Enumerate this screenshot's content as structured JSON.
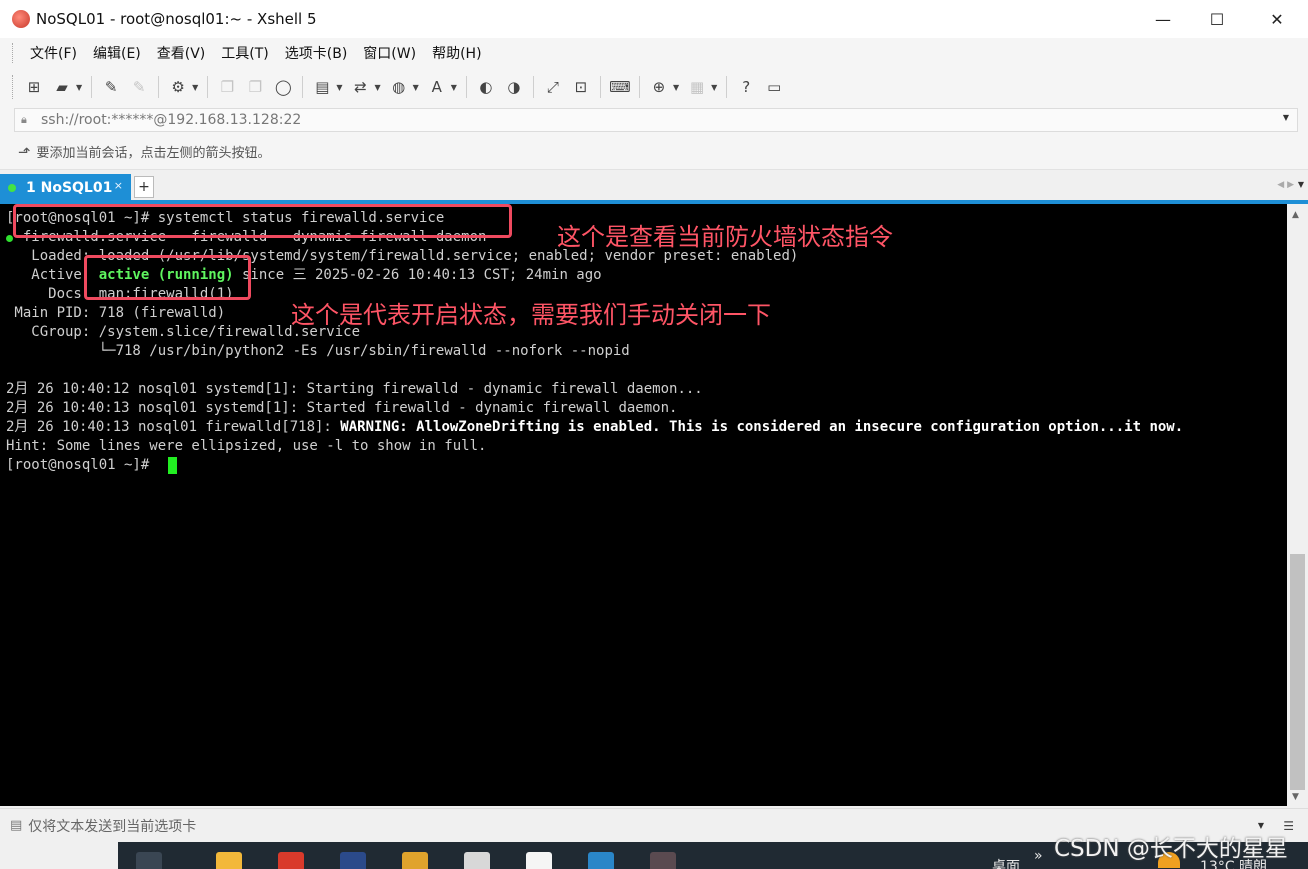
{
  "window": {
    "title": "NoSQL01 - root@nosql01:~ - Xshell 5",
    "minimize": "—",
    "maximize": "☐",
    "close": "✕"
  },
  "menu": [
    "文件(F)",
    "编辑(E)",
    "查看(V)",
    "工具(T)",
    "选项卡(B)",
    "窗口(W)",
    "帮助(H)"
  ],
  "address": {
    "url": "ssh://root:******@192.168.13.128:22"
  },
  "hint": {
    "text": "要添加当前会话，点击左侧的箭头按钮。"
  },
  "tab": {
    "label": "1 NoSQL01",
    "close": "×",
    "add": "+"
  },
  "terminal": {
    "lines": [
      "[root@nosql01 ~]# systemctl status firewalld.service",
      "  firewalld.service - firewalld - dynamic firewall daemon",
      "   Loaded: loaded (/usr/lib/systemd/system/firewalld.service; enabled; vendor preset: enabled)",
      {
        "pre": "   Active: ",
        "hl": "active (running)",
        "post": " since 三 2025-02-26 10:40:13 CST; 24min ago"
      },
      "     Docs: man:firewalld(1)",
      " Main PID: 718 (firewalld)",
      "   CGroup: /system.slice/firewalld.service",
      "           └─718 /usr/bin/python2 -Es /usr/sbin/firewalld --nofork --nopid",
      "",
      "2月 26 10:40:12 nosql01 systemd[1]: Starting firewalld - dynamic firewall daemon...",
      "2月 26 10:40:13 nosql01 systemd[1]: Started firewalld - dynamic firewall daemon.",
      {
        "pre": "2月 26 10:40:13 nosql01 firewalld[718]: ",
        "bold": "WARNING: AllowZoneDrifting is enabled. This is considered an insecure configuration option...it now."
      },
      "Hint: Some lines were ellipsized, use -l to show in full.",
      "[root@nosql01 ~]# "
    ]
  },
  "annotations": {
    "command_note": "这个是查看当前防火墙状态指令",
    "status_note": "这个是代表开启状态，需要我们手动关闭一下"
  },
  "compose": {
    "text": "仅将文本发送到当前选项卡"
  },
  "taskbar": {
    "desktop": "桌面",
    "weather": "13°C  晴朗",
    "chevron": "»"
  },
  "watermark": "CSDN @长不大的星星",
  "colors": {
    "tab_accent": "#1e8fd6",
    "terminal_bg": "#000000",
    "active_green": "#5ff55f",
    "annotation_red": "#ef4a5f"
  }
}
